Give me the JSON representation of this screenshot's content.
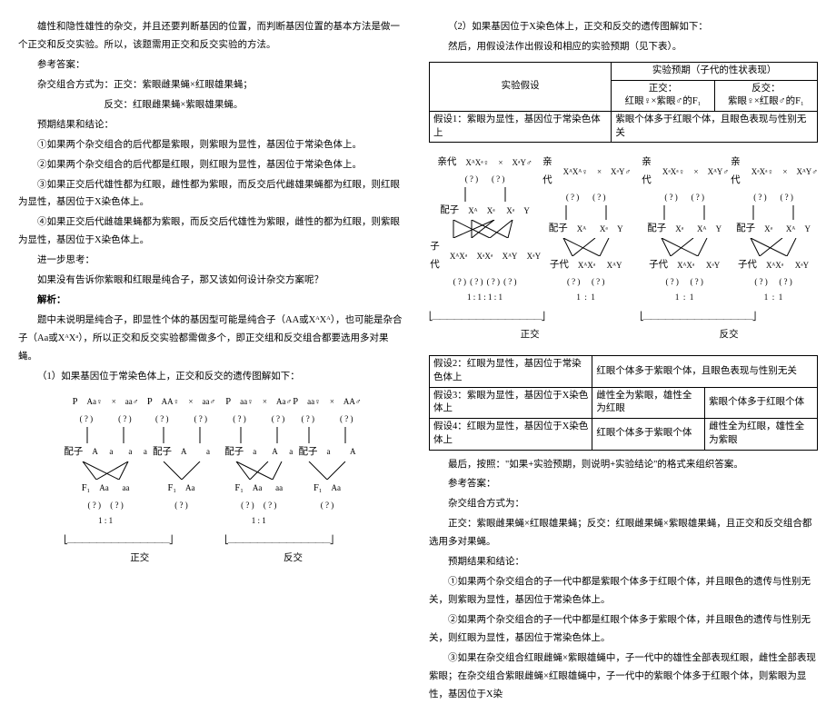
{
  "left": {
    "p1": "雄性和隐性雄性的杂交，并且还要判断基因的位置，而判断基因位置的基本方法是做一个正交和反交实验。所以，该题需用正交和反交实验的方法。",
    "p2": "参考答案：",
    "p3": "杂交组合方式为：正交：紫眼雌果蝇×红眼雄果蝇；",
    "p4": "反交：红眼雌果蝇×紫眼雄果蝇。",
    "p5": "预期结果和结论：",
    "p6": "①如果两个杂交组合的后代都是紫眼，则紫眼为显性，基因位于常染色体上。",
    "p7": "②如果两个杂交组合的后代都是红眼，则红眼为显性，基因位于常染色体上。",
    "p8": "③如果正交后代雄性都为红眼，雌性都为紫眼，而反交后代雌雄果蝇都为红眼，则红眼为显性，基因位于X染色体上。",
    "p9": "④如果正交后代雌雄果蝇都为紫眼，而反交后代雄性为紫眼，雌性的都为红眼，则紫眼为显性，基因位于X染色体上。",
    "p10": "进一步思考：",
    "p11": "如果没有告诉你紫眼和红眼是纯合子，那又该如何设计杂交方案呢？",
    "p12": "解析：",
    "p13": "题中未说明是纯合子，即显性个体的基因型可能是纯合子（AA或XᴬXᴬ），也可能是杂合子（Aa或XᴬXᵃ），所以正交和反交实验都需做多个，即正交组和反交组合都要选用多对果蝇。",
    "p14": "（1）如果基因位于常染色体上，正交和反交的遗传图解如下：",
    "cap1": "正交",
    "cap2": "反交",
    "punnett": {
      "P_lbl": "P",
      "gamete_lbl": "配子",
      "F1_lbl": "F₁",
      "pairs": [
        {
          "l": "Aa♀",
          "r": "aa♂"
        },
        {
          "l": "AA♀",
          "r": "aa♂"
        },
        {
          "l": "aa♀",
          "r": "Aa♂"
        },
        {
          "l": "aa♀",
          "r": "AA♂"
        }
      ],
      "q": "( ? )",
      "gametes": [
        "A",
        "a",
        "a",
        "a"
      ],
      "F1_a": "Aa",
      "F1_b": "aa",
      "ratio": "1   :   1"
    }
  },
  "right": {
    "p1": "（2）如果基因位于X染色体上，正交和反交的遗传图解如下：",
    "p2": "然后，用假设法作出假设和相应的实验预期（见下表）。",
    "table1": {
      "h_hyp": "实验假设",
      "h_exp": "实验预期（子代的性状表现）",
      "h_zx": "正交：",
      "h_fx": "反交：",
      "h_zx2": "红眼♀×紫眼♂的F₁",
      "h_fx2": "紫眼♀×红眼♂的F₁",
      "r1a": "假设1：紫眼为显性，基因位于常染色体上",
      "r1b": "紫眼个体多于红眼个体，且眼色表现与性别无关"
    },
    "xdiag": {
      "parent": "亲代",
      "gamete": "配子",
      "child": "子代",
      "pairs": [
        {
          "l": "XᴬXᵃ♀",
          "r": "XᵃY♂"
        },
        {
          "l": "XᴬXᴬ♀",
          "r": "XᵃY♂"
        },
        {
          "l": "XᵃXᵃ♀",
          "r": "XᴬY♂"
        },
        {
          "l": "XᵃXᵃ♀",
          "r": "XᴬY♂"
        }
      ],
      "g": [
        "Xᴬ",
        "Xᵃ",
        "Xᵃ",
        "Y"
      ],
      "c": [
        "XᴬXᵃ",
        "XᵃXᵃ",
        "XᴬY",
        "XᵃY"
      ],
      "q": "( ? )",
      "ratio": "1 : 1 : 1 : 1",
      "cap1": "正交",
      "cap2": "反交"
    },
    "table2": {
      "r2a": "假设2：红眼为显性，基因位于常染色体上",
      "r2b": "红眼个体多于紫眼个体，且眼色表现与性别无关",
      "r3a": "假设3：紫眼为显性，基因位于X染色体上",
      "r3b": "雌性全为紫眼，雄性全为红眼",
      "r3c": "紫眼个体多于红眼个体",
      "r4a": "假设4：红眼为显性，基因位于X染色体上",
      "r4b": "红眼个体多于紫眼个体",
      "r4c": "雌性全为红眼，雄性全为紫眼"
    },
    "p3": "最后，按照：\"如果+实验预期，则说明+实验结论\"的格式来组织答案。",
    "p4": "参考答案：",
    "p5": "杂交组合方式为：",
    "p6": "正交：紫眼雌果蝇×红眼雄果蝇；反交：红眼雌果蝇×紫眼雄果蝇，且正交和反交组合都选用多对果蝇。",
    "p7": "预期结果和结论：",
    "p8": "①如果两个杂交组合的子一代中都是紫眼个体多于红眼个体，并且眼色的遗传与性别无关，则紫眼为显性，基因位于常染色体上。",
    "p9": "②如果两个杂交组合的子一代中都是红眼个体多于紫眼个体，并且眼色的遗传与性别无关，则红眼为显性，基因位于常染色体上。",
    "p10": "③如果在杂交组合红眼雌蝇×紫眼雄蝇中，子一代中的雄性全部表现红眼，雌性全部表现紫眼；在杂交组合紫眼雌蝇×红眼雄蝇中，子一代中的紫眼个体多于红眼个体，则紫眼为显性，基因位于X染"
  }
}
